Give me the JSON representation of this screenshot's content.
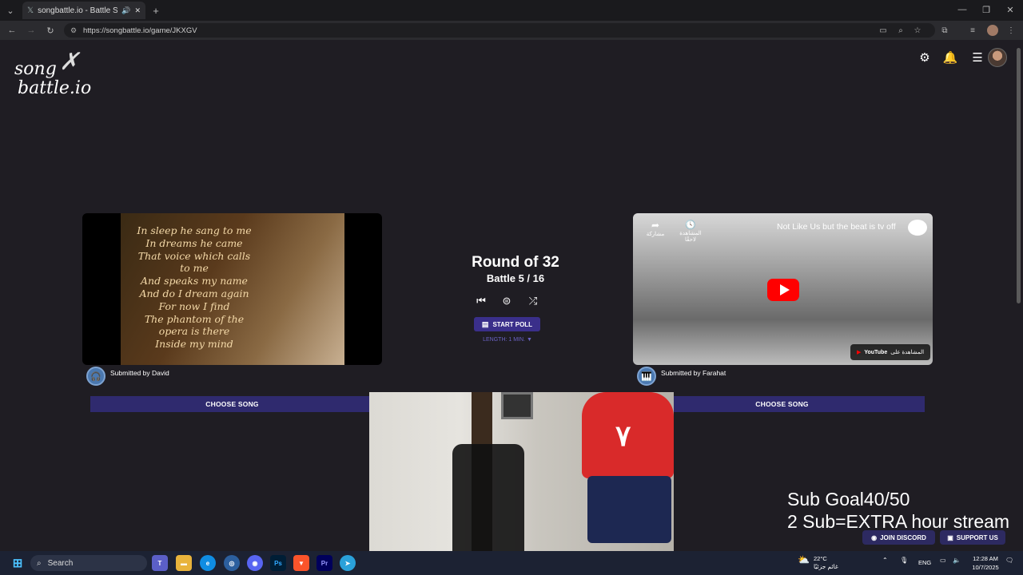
{
  "browser": {
    "tab_title": "songbattle.io - Battle Song",
    "url": "https://songbattle.io/game/JKXGV",
    "tab_add": "+",
    "win_min": "—",
    "win_max": "❐",
    "win_close": "✕"
  },
  "site": {
    "logo_line1": "song",
    "logo_line2": "battle.io"
  },
  "game": {
    "round": "Round of 32",
    "battle": "Battle 5 / 16",
    "start_poll": "START POLL",
    "length": "LENGTH: 1 MIN. ▼"
  },
  "left_song": {
    "lyrics": [
      "In sleep he sang to me",
      "In dreams he came",
      "That voice which calls",
      "to me",
      "And speaks my name",
      "And do I dream again",
      "For now I find",
      "The phantom of the",
      "opera is there",
      "Inside my mind"
    ],
    "submitted": "Submitted by David",
    "choose": "CHOOSE SONG"
  },
  "right_song": {
    "title": "Not Like Us but the beat is tv off",
    "share_label": "مشاركة",
    "watch_later_label": "المشاهدة لاحقًا",
    "watch_on_label": "المشاهدة على",
    "youtube_label": "YouTube",
    "submitted": "Submitted by Farahat",
    "choose": "CHOOSE SONG"
  },
  "overlay": {
    "sub_goal": "Sub Goal40/50",
    "extra": "2 Sub=EXTRA hour stream",
    "join_discord": "JOIN DISCORD",
    "support_us": "SUPPORT US"
  },
  "taskbar": {
    "search": "Search",
    "weather_temp": "22°C",
    "weather_desc": "غائم جزئيًا",
    "lang": "ENG",
    "time": "12:28 AM",
    "date": "10/7/2025",
    "app_ps": "Ps",
    "app_pr": "Pr"
  },
  "colors": {
    "page_bg": "#1f1d23",
    "accent": "#2f2a6e",
    "poll_button": "#3a2f8a",
    "length_text": "#6a62c4"
  }
}
